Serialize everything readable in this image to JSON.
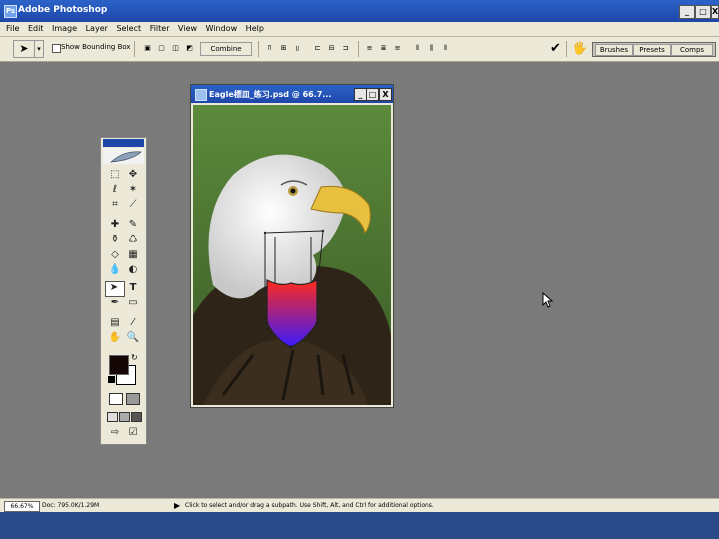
{
  "app": {
    "title": "Adobe Photoshop",
    "icon": "photoshop-app-icon",
    "window_buttons": [
      "_",
      "□",
      "X"
    ]
  },
  "menu": [
    "File",
    "Edit",
    "Image",
    "Layer",
    "Select",
    "Filter",
    "View",
    "Window",
    "Help"
  ],
  "options": {
    "show_bounding_box": "Show Bounding Box",
    "combine": "Combine",
    "palette_tabs": [
      "Brushes",
      "Presets",
      "Comps"
    ]
  },
  "document": {
    "title": "Eagle標皿_练习.psd @ 66.7...",
    "window_buttons": [
      "_",
      "□",
      "X"
    ]
  },
  "status": {
    "zoom": "66.67%",
    "doc_size": "Doc: 795.0K/1.29M",
    "hint": "Click to select and/or drag a subpath. Use Shift, Alt, and Ctrl for additional options."
  },
  "colors": {
    "titlebar": "#2c63c9",
    "canvas": "#7a7a7a",
    "chrome": "#ece9d8",
    "shield_top": "#ff2a1a",
    "shield_bottom": "#3a1aff"
  },
  "icons": {
    "tools": [
      "marquee-icon",
      "move-icon",
      "lasso-icon",
      "magic-wand-icon",
      "crop-icon",
      "slice-icon",
      "healing-brush-icon",
      "brush-icon",
      "clone-stamp-icon",
      "history-brush-icon",
      "eraser-icon",
      "gradient-icon",
      "blur-icon",
      "dodge-icon",
      "path-selection-icon",
      "type-icon",
      "pen-icon",
      "shape-icon",
      "notes-icon",
      "eyedropper-icon",
      "hand-icon",
      "zoom-icon"
    ]
  }
}
